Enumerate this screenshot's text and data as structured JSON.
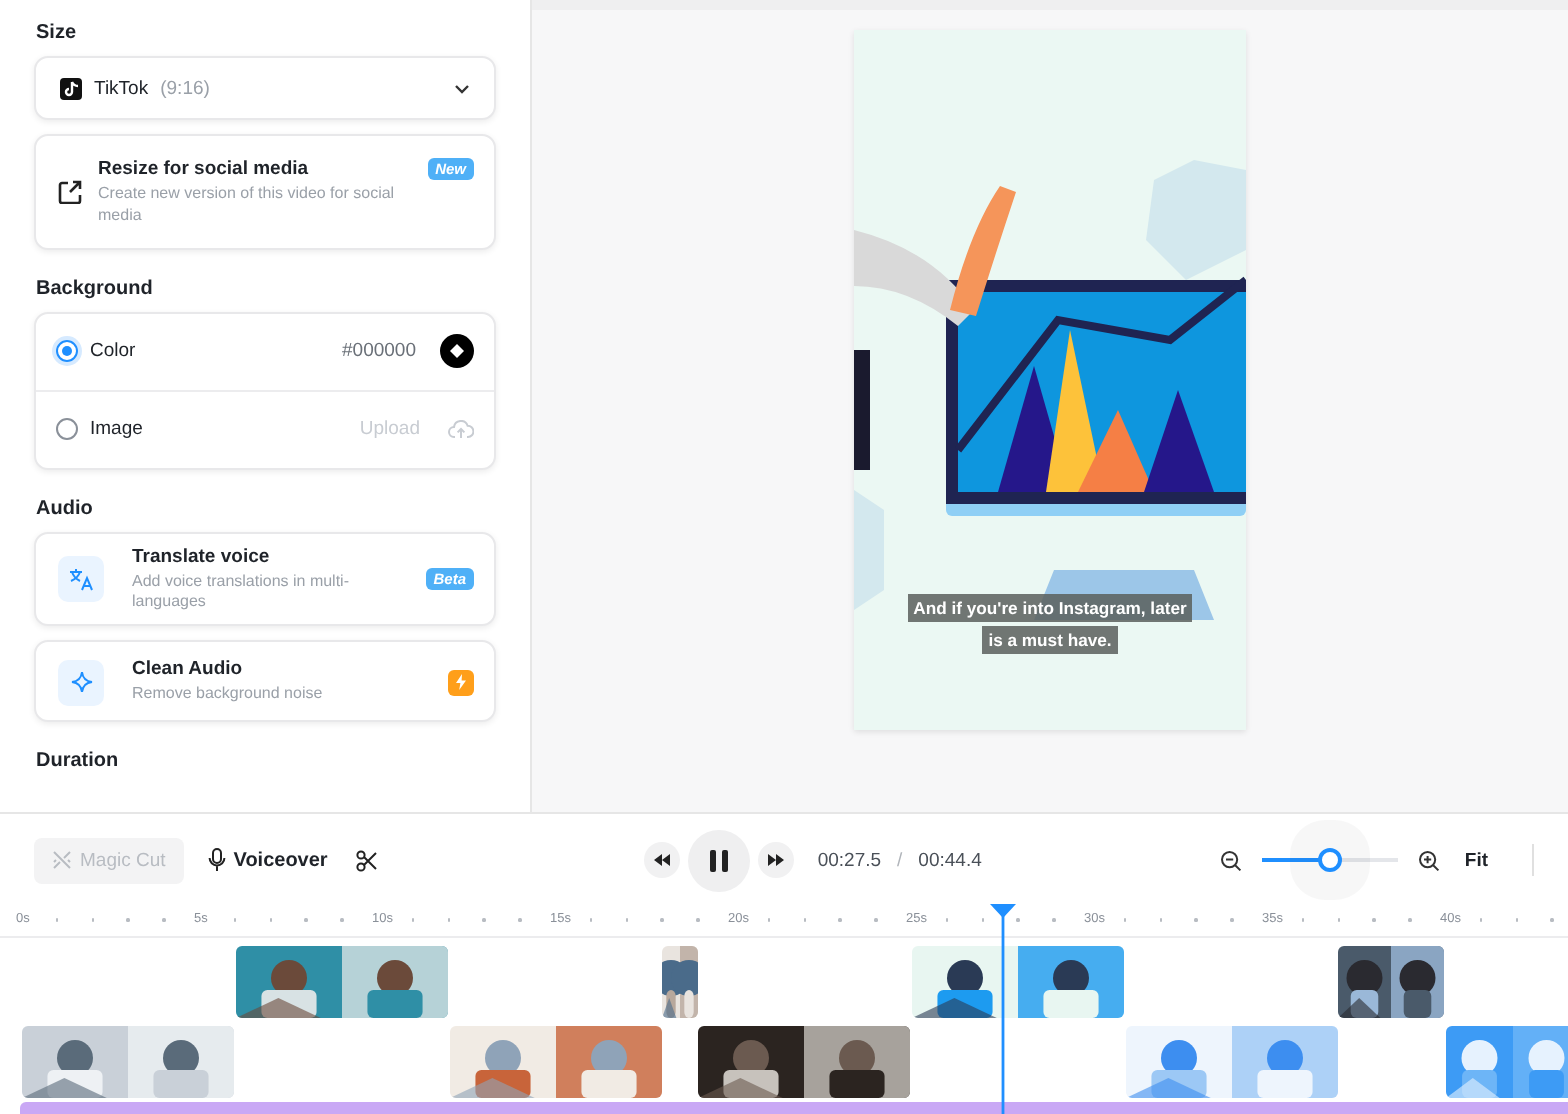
{
  "size": {
    "heading": "Size",
    "platform": "TikTok",
    "ratio": "(9:16)"
  },
  "resize": {
    "title": "Resize for social media",
    "description": "Create new version of this video for social media",
    "badge": "New"
  },
  "background": {
    "heading": "Background",
    "options": [
      {
        "kind": "color",
        "label": "Color",
        "selected": true,
        "value": "#000000"
      },
      {
        "label": "Image",
        "selected": false,
        "action": "Upload"
      }
    ]
  },
  "audio": {
    "heading": "Audio",
    "tools": [
      {
        "kind": "translate",
        "title": "Translate voice",
        "description": "Add voice translations in multi-languages",
        "badge": "Beta"
      },
      {
        "kind": "clean",
        "title": "Clean Audio",
        "description": "Remove background noise"
      }
    ]
  },
  "duration": {
    "heading": "Duration"
  },
  "preview": {
    "subtitle_lines": [
      "And if you're into Instagram, later",
      "is a must have."
    ]
  },
  "toolbar": {
    "magic_cut": {
      "label": "Magic Cut",
      "disabled": true
    },
    "voiceover": "Voiceover",
    "current_time": "00:27.5",
    "separator": "/",
    "total_time": "00:44.4",
    "zoom": {
      "level": 0.5
    },
    "fit": "Fit"
  },
  "ruler": {
    "labels": [
      "0s",
      "5s",
      "10s",
      "15s",
      "20s",
      "25s",
      "30s",
      "35s",
      "40s"
    ]
  }
}
